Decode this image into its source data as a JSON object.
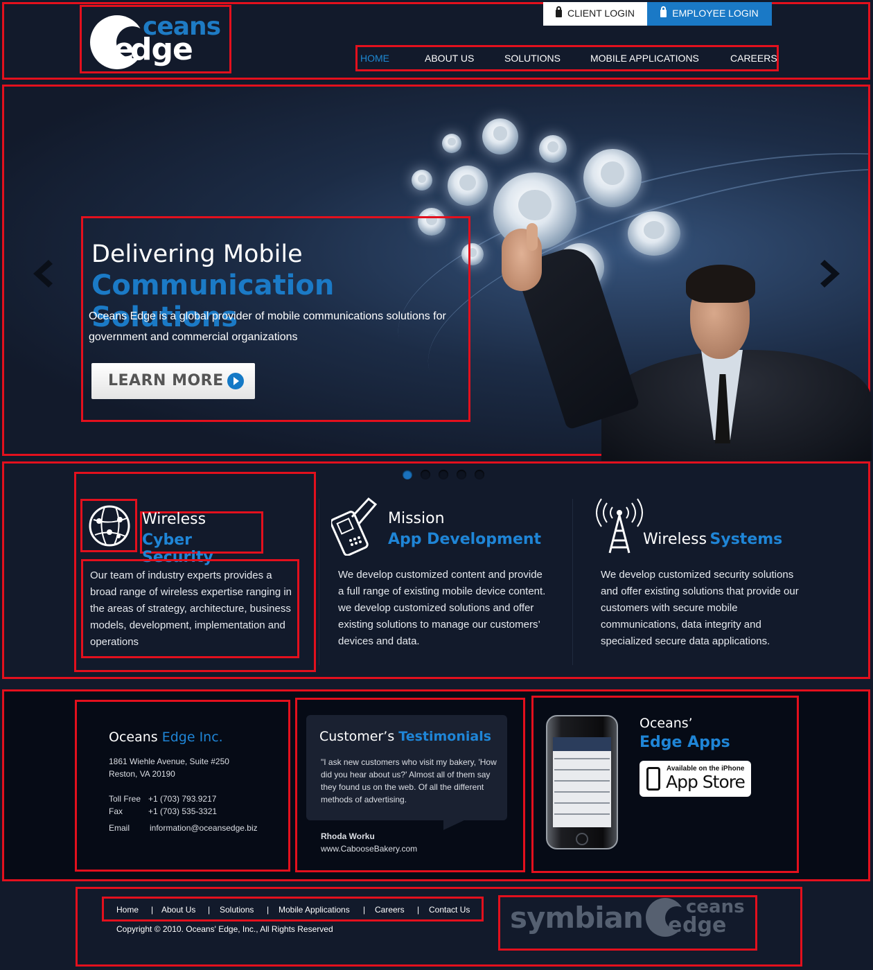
{
  "header": {
    "logo": {
      "word1": "ceans",
      "word2": "dge",
      "letter_e": "e"
    },
    "client_login": "CLIENT  LOGIN",
    "employee_login": "EMPLOYEE LOGIN",
    "nav": [
      "HOME",
      "ABOUT US",
      "SOLUTIONS",
      "MOBILE APPLICATIONS",
      "CAREERS"
    ],
    "active_nav": "HOME"
  },
  "hero": {
    "line1": "Delivering Mobile",
    "line2": "Communication Solutions",
    "description": "Oceans Edge is a global provider of mobile communications solutions for government and commercial organizations",
    "button": "LEARN MORE",
    "slider_dots": 5,
    "active_dot": 1
  },
  "features": [
    {
      "title_white": "Wireless",
      "title_blue": "Cyber Security",
      "icon": "globe-network-icon",
      "text": "Our team of industry experts provides a broad range of wireless expertise ranging in the areas of strategy, architecture, business models, development, implementation and operations"
    },
    {
      "title_white": "Mission",
      "title_blue": "App Development",
      "icon": "mobile-phone-icon",
      "text": "We develop customized content and provide a full range of existing mobile device content. we develop customized solutions and offer existing solutions to manage our customers’ devices and data."
    },
    {
      "title_white": "Wireless",
      "title_blue": "Systems",
      "icon": "radio-tower-icon",
      "text": "We develop customized security solutions and offer existing solutions that provide our customers with secure mobile communications, data integrity and specialized secure data applications."
    }
  ],
  "contact": {
    "title_white": "Oceans ",
    "title_blue": "Edge Inc.",
    "address1": "1861 Wiehle Avenue, Suite #250",
    "address2": "Reston, VA 20190",
    "tollfree_label": "Toll Free",
    "tollfree": "+1  (703) 793.9217",
    "fax_label": "Fax",
    "fax": "+1 (703) 535-3321",
    "email_label": "Email",
    "email": "information@oceansedge.biz"
  },
  "testimonials": {
    "title_white": "Customer’s ",
    "title_blue": "Testimonials",
    "quote": "\"I ask new customers who visit my bakery, 'How did you hear about us?' Almost all of them say they found us on the web. Of all the different methods of advertising.",
    "author": "Rhoda Worku",
    "website": "www.CabooseBakery.com"
  },
  "apps": {
    "title_white": "Oceans’",
    "title_blue": "Edge Apps",
    "badge_small": "Available on the iPhone",
    "badge_big": "App Store"
  },
  "footer": {
    "links": [
      "Home",
      "About Us",
      "Solutions",
      "Mobile Applications",
      "Careers",
      "Contact Us"
    ],
    "separator": "|",
    "copyright": "Copyright © 2010. Oceans' Edge, Inc., All Rights Reserved",
    "partner1": "symbian",
    "partner2_word1": "ceans",
    "partner2_word2": "dge",
    "partner2_letter": "e"
  },
  "colors": {
    "background": "#121a2b",
    "accent_blue": "#1e7bc4",
    "footer_dark": "#060b16",
    "annotation_red": "#e3101d"
  }
}
